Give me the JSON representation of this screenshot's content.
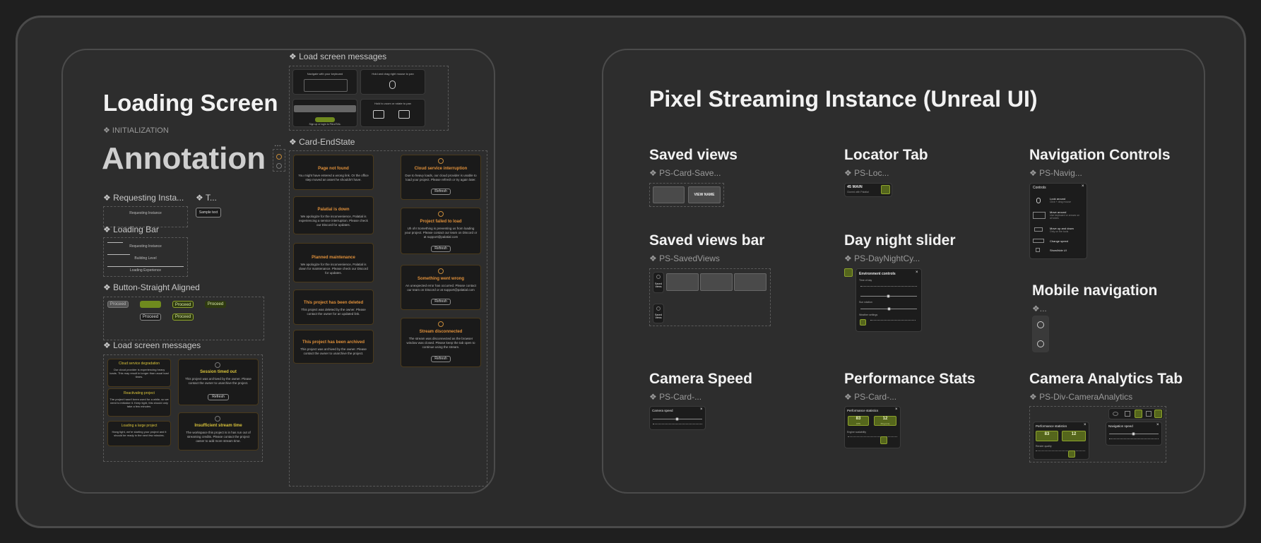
{
  "left_panel": {
    "title": "Loading Screen",
    "init_label": "❖ INITIALIZATION",
    "annotation": "Annotation",
    "requesting_label": "❖ Requesting Insta...",
    "t_label": "❖ T...",
    "requesting_instance": "Requesting Instance",
    "sample_text": "Sample text",
    "loading_bar_label": "❖ Loading Bar",
    "loading_bar_items": [
      "Requesting Instance",
      "Building Level",
      "Loading Experience"
    ],
    "button_label": "❖ Button-Straight Aligned",
    "proceed": "Proceed",
    "load_msgs_label": "❖ Load screen messages",
    "load_msgs_top_label": "❖ Load screen messages",
    "ellipsis": "...",
    "cards_small": [
      {
        "title": "Cloud service degradation",
        "body": "Our cloud provider is experiencing heavy loads. This may result in longer than usual load times."
      },
      {
        "title": "Reactivating project",
        "body": "The project hasn't been used for a while, so we need to initialize it. Keep tight, this should only take a few minutes."
      },
      {
        "title": "Loading a large project",
        "body": "Hang tight, we're starting your project and it should be ready in the next few minutes."
      }
    ],
    "session_timed_out": {
      "title": "Session timed out",
      "body": "This project was archived by the owner. Please contact the owner to unarchive the project.",
      "button": "Refresh"
    },
    "insufficient": {
      "title": "Insufficient stream time",
      "body": "The workspace this project is in has run out of streaming credits. Please contact the project owner to add more stream time."
    },
    "top_msgs": {
      "keyboard": "Navigate with your keyboard",
      "mouse": "Hold and drag right mouse to pan",
      "zoom": "Hold to zoom or rotate to pan",
      "signin": "Sign up or login to PALATIAL"
    },
    "card_endstate_label": "❖ Card-EndState",
    "end_cards_left": [
      {
        "title": "Page not found",
        "body": "You might have entered a wrong link. Or the office step moved an asset he shouldn't have."
      },
      {
        "title": "Palatial is down",
        "body": "We apologize for the inconvenience, Palatial is experiencing a service interruption. Please check our Discord for updates."
      },
      {
        "title": "Planned maintenance",
        "body": "We apologize for the inconvenience, Palatial is down for maintenance. Please check our Discord for updates."
      },
      {
        "title": "This project has been deleted",
        "body": "This project was deleted by the owner. Please contact the owner for an updated link."
      },
      {
        "title": "This project has been archived",
        "body": "This project was archived by the owner. Please contact the owner to unarchive the project."
      }
    ],
    "end_cards_right": [
      {
        "title": "Cloud service interruption",
        "body": "Due to heavy loads, our cloud provider is unable to load your project. Please refresh or try again later.",
        "button": "Refresh"
      },
      {
        "title": "Project failed to load",
        "body": "Uh oh! Something is preventing us from loading your project. Please contact our team on Discord or at support@palatial.com",
        "button": "Refresh"
      },
      {
        "title": "Something went wrong",
        "body": "An unexpected error has occurred. Please contact our team on Discord or at support@palatial.com",
        "button": "Refresh"
      },
      {
        "title": "Stream disconnected",
        "body": "The stream was disconnected as the browser window was closed. Please keep the tab open to continue using the stream.",
        "button": "Refresh"
      }
    ]
  },
  "right_panel": {
    "title": "Pixel Streaming Instance (Unreal UI)",
    "saved_views": {
      "title": "Saved views",
      "sub": "❖ PS-Card-Save...",
      "button": "VIEW NAME"
    },
    "locator": {
      "title": "Locator Tab",
      "sub": "❖ PS-Loc...",
      "name": "45 MAIN",
      "detail": "Cloned with Palatial"
    },
    "nav_controls": {
      "title": "Navigation Controls",
      "sub": "❖ PS-Navig...",
      "header": "Controls",
      "items": [
        {
          "label": "Look around",
          "hint": "Click + drag mouse"
        },
        {
          "label": "Move around",
          "hint": "Use keyboard or arrows on all sides"
        },
        {
          "label": "Move up and down",
          "hint": "Only on the tools"
        },
        {
          "label": "Change speed",
          "hint": ""
        },
        {
          "label": "Show/hide UI",
          "hint": ""
        }
      ]
    },
    "saved_views_bar": {
      "title": "Saved views bar",
      "sub": "❖ PS-SavedViews",
      "side1": "Saved Views",
      "side2": "Saved Views"
    },
    "day_night": {
      "title": "Day night slider",
      "sub": "❖ PS-DayNightCy...",
      "header": "Environment controls",
      "time_label": "Time of day",
      "sun_label": "Sun rotation",
      "weather_label": "Weather settings"
    },
    "mobile_nav": {
      "title": "Mobile navigation",
      "sub": "❖..."
    },
    "camera_speed": {
      "title": "Camera Speed",
      "sub": "❖ PS-Card-...",
      "header": "Camera speed"
    },
    "perf_stats": {
      "title": "Performance Stats",
      "sub": "❖ PS-Card-...",
      "header": "Performance statistics",
      "fps": "83",
      "fps_label": "FPS",
      "ping": "12",
      "ping_label": "Ping (ms)",
      "quality_label": "Engine scalability"
    },
    "camera_analytics": {
      "title": "Camera Analytics Tab",
      "sub": "❖ PS-Div-CameraAnalytics",
      "perf_header": "Performance statistics",
      "nav_header": "Navigation speed",
      "fps": "83",
      "ping": "12",
      "quality_label": "Render quality"
    }
  }
}
